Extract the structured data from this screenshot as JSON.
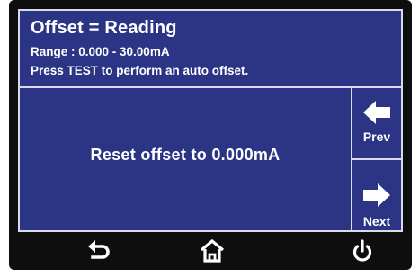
{
  "header": {
    "title": "Offset = Reading",
    "range": "Range : 0.000 - 30.00mA",
    "hint": "Press TEST to perform an auto offset."
  },
  "main": {
    "message": "Reset offset to 0.000mA"
  },
  "nav": {
    "prev_label": "Prev",
    "next_label": "Next"
  },
  "bottom_bar": {
    "back_icon": "back-arrow-icon",
    "home_icon": "home-icon",
    "power_icon": "power-icon"
  },
  "colors": {
    "screen_background": "#2c3585",
    "bezel": "#0e0e0e",
    "text": "#ffffff",
    "divider": "#d8dbe8"
  }
}
